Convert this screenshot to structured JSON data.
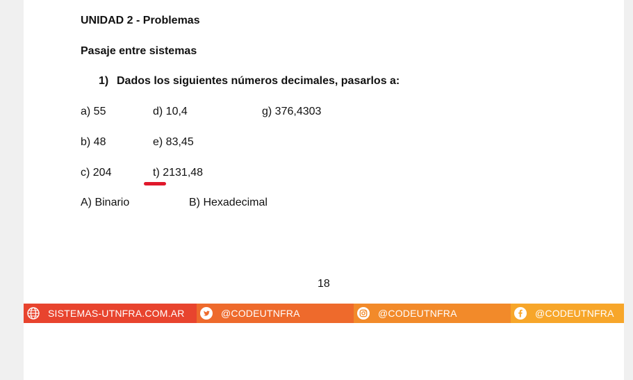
{
  "document": {
    "unit_title": "UNIDAD 2 - Problemas",
    "section_title": "Pasaje entre sistemas",
    "problem": {
      "number": "1)",
      "statement": "Dados los siguientes números decimales, pasarlos a:"
    },
    "items": {
      "a": "a) 55",
      "b": "b) 48",
      "c": "c) 204",
      "d": "d) 10,4",
      "e": "e) 83,45",
      "t": "t) 2131,48",
      "g": "g) 376,4303"
    },
    "targets": {
      "A": "A) Binario",
      "B": "B) Hexadecimal"
    },
    "page_number": "18",
    "annotation_color": "#e0182b"
  },
  "footer": {
    "website": "SISTEMAS-UTNFRA.COM.AR",
    "twitter": "@CODEUTNFRA",
    "instagram": "@CODEUTNFRA",
    "facebook": "@CODEUTNFRA",
    "colors": [
      "#e8442e",
      "#ee6a2c",
      "#f28a2a",
      "#f7a62a"
    ]
  }
}
